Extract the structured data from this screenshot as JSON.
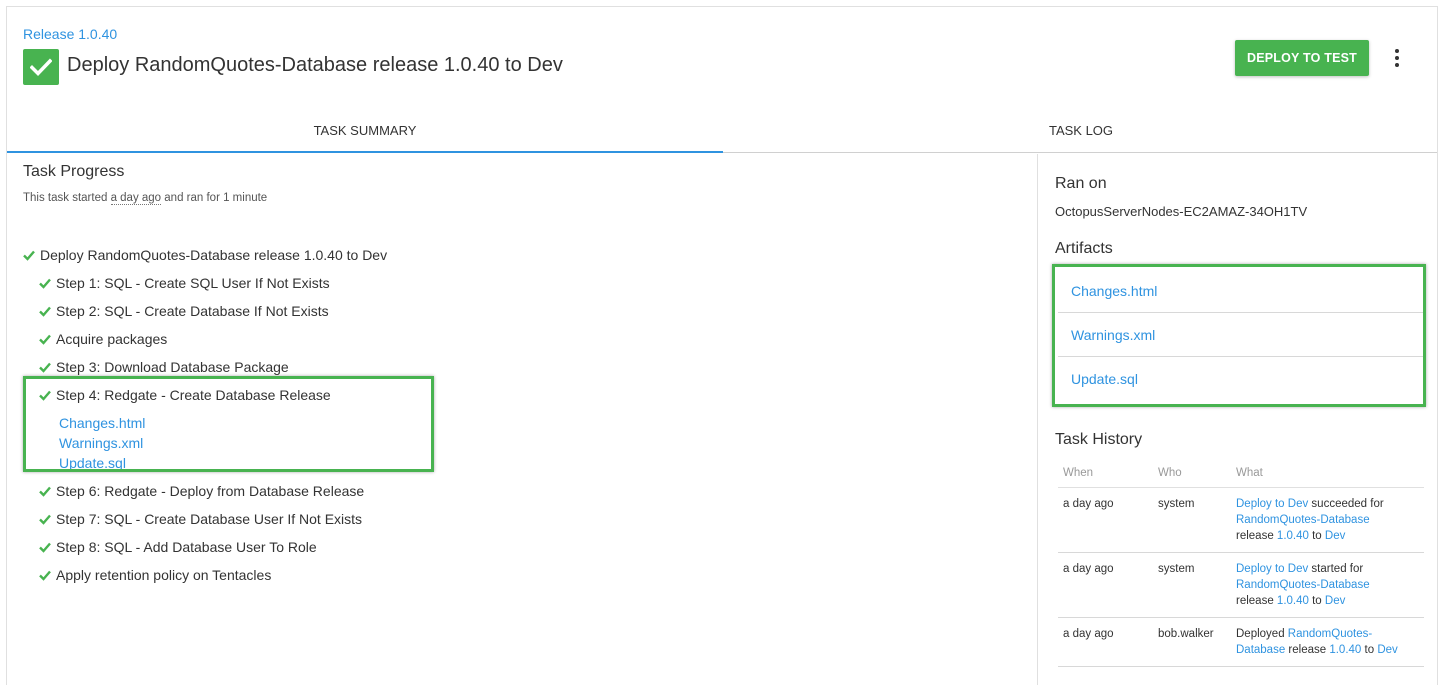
{
  "header": {
    "release_link": "Release 1.0.40",
    "title": "Deploy RandomQuotes-Database release 1.0.40 to Dev",
    "deploy_button": "DEPLOY TO TEST"
  },
  "tabs": [
    {
      "label": "TASK SUMMARY",
      "active": true
    },
    {
      "label": "TASK LOG",
      "active": false
    }
  ],
  "task_progress": {
    "title": "Task Progress",
    "subtitle_prefix": "This task started ",
    "subtitle_started": "a day ago",
    "subtitle_suffix": " and ran for 1 minute",
    "root": "Deploy RandomQuotes-Database release 1.0.40 to Dev",
    "steps": [
      "Step 1: SQL - Create SQL User If Not Exists",
      "Step 2: SQL - Create Database If Not Exists",
      "Acquire packages",
      "Step 3: Download Database Package",
      "Step 4: Redgate - Create Database Release",
      "Step 6: Redgate - Deploy from Database Release",
      "Step 7: SQL - Create Database User If Not Exists",
      "Step 8: SQL - Add Database User To Role",
      "Apply retention policy on Tentacles"
    ],
    "step4_artifacts": [
      "Changes.html",
      "Warnings.xml",
      "Update.sql"
    ]
  },
  "ran_on": {
    "title": "Ran on",
    "value": "OctopusServerNodes-EC2AMAZ-34OH1TV"
  },
  "artifacts": {
    "title": "Artifacts",
    "items": [
      "Changes.html",
      "Warnings.xml",
      "Update.sql"
    ]
  },
  "task_history": {
    "title": "Task History",
    "columns": [
      "When",
      "Who",
      "What"
    ],
    "rows": [
      {
        "when": "a day ago",
        "who": "system",
        "w1": "Deploy to Dev",
        "w2": " succeeded for ",
        "w3": "RandomQuotes-Database",
        "w4": "release ",
        "w5": "1.0.40",
        "w6": " to ",
        "w7": "Dev"
      },
      {
        "when": "a day ago",
        "who": "system",
        "w1": "Deploy to Dev",
        "w2": " started for ",
        "w3": "RandomQuotes-Database",
        "w4": "release ",
        "w5": "1.0.40",
        "w6": " to ",
        "w7": "Dev"
      },
      {
        "when": "a day ago",
        "who": "bob.walker",
        "w1": "Deployed ",
        "w2": "RandomQuotes-",
        "w3": "Database",
        "w4": " release ",
        "w5": "1.0.40",
        "w6": " to ",
        "w7": "Dev"
      }
    ]
  },
  "colors": {
    "success_green": "#48b350",
    "link_blue": "#2f93e0",
    "tab_underline": "#2f93e0"
  }
}
